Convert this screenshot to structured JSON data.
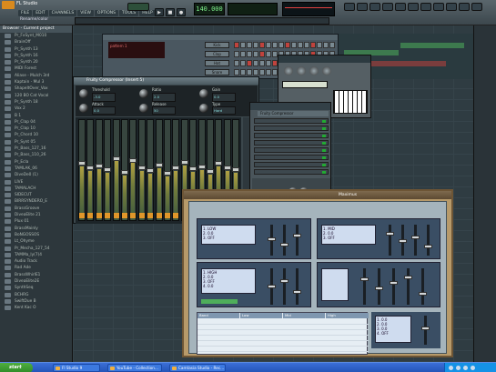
{
  "app": {
    "title": "FL Studio",
    "menu": [
      "FILE",
      "EDIT",
      "CHANNELS",
      "VIEW",
      "OPTIONS",
      "TOOLS",
      "HELP"
    ],
    "hint": "Rename/color",
    "tempo": "140.000"
  },
  "browser": {
    "header": "Browser - Current project",
    "items": [
      "Pr_FxSynt_M010",
      "BrainOff",
      "Pr_Synth 13",
      "Pr_Synth 16",
      "Pr_Synth 20",
      "MIDI Forest",
      "Aliase - Mulch 3rd",
      "Kaptain - Mul 3",
      "ShapeItOver_Vox",
      "120 BO Cat Vocal",
      "Pr_Synth 18",
      "Vox 2",
      "B 1",
      "Pr_Clap 04",
      "Pr_Clap 10",
      "Pr_Chord 10",
      "Pr_Synt 05",
      "Pr_Bass_127_16",
      "Pr_Bass_110_26",
      "Pr_Ecla",
      "TAMLAK_06",
      "DiveDe0 (1)",
      "LIVE",
      "TAMALACH",
      "SIDECUT",
      "BIRRSYNDERO_E",
      "BrassGroove",
      "DiveaElite 21",
      "Plux 01",
      "BrassMainly",
      "BoNGOSSOS",
      "Lt_Ohyme",
      "Pr_Mecha_127_54",
      "TAMMa_ly(7)4",
      "Audio Track",
      "Rad Ade",
      "BrassWhirlE1",
      "DiveaElite2E",
      "SynthSeq",
      "BCHRG",
      "SwiftDue B",
      "Kent Kac O"
    ]
  },
  "channels": [
    {
      "name": "Kick",
      "steps": [
        1,
        0,
        0,
        0,
        1,
        0,
        0,
        0,
        1,
        0,
        0,
        0,
        1,
        0,
        0,
        0
      ]
    },
    {
      "name": "Clap",
      "steps": [
        0,
        0,
        0,
        0,
        1,
        0,
        0,
        0,
        0,
        0,
        0,
        0,
        1,
        0,
        0,
        0
      ]
    },
    {
      "name": "Hat",
      "steps": [
        0,
        0,
        1,
        0,
        0,
        0,
        1,
        0,
        0,
        0,
        1,
        0,
        0,
        0,
        1,
        0
      ]
    },
    {
      "name": "Snare",
      "steps": [
        0,
        0,
        0,
        0,
        0,
        0,
        0,
        0,
        0,
        0,
        0,
        0,
        0,
        0,
        0,
        0
      ]
    }
  ],
  "compressor": {
    "title": "Fruity Compressor (Insert 5)",
    "knobs": [
      {
        "label": "Threshold",
        "value": "-3.0"
      },
      {
        "label": "Ratio",
        "value": "2.0"
      },
      {
        "label": "Gain",
        "value": "0.0"
      },
      {
        "label": "Attack",
        "value": "0.0"
      },
      {
        "label": "Release",
        "value": "50"
      },
      {
        "label": "Type",
        "value": "Hard"
      }
    ],
    "fader_levels": [
      0.55,
      0.5,
      0.52,
      0.48,
      0.6,
      0.45,
      0.58,
      0.5,
      0.47,
      0.53,
      0.44,
      0.5,
      0.56,
      0.49,
      0.51,
      0.46,
      0.55,
      0.5,
      0.48
    ]
  },
  "mixer": {
    "fx_title": "Fruity Compressor"
  },
  "plugin": {
    "title": "Maximus",
    "table_headers": [
      "Band",
      "Low",
      "Mid",
      "High"
    ]
  },
  "taskbar": {
    "start": "start",
    "buttons": [
      "Fl Studio 9",
      "YouTube - Collection...",
      "Camtasia Studio - Rec..."
    ]
  }
}
